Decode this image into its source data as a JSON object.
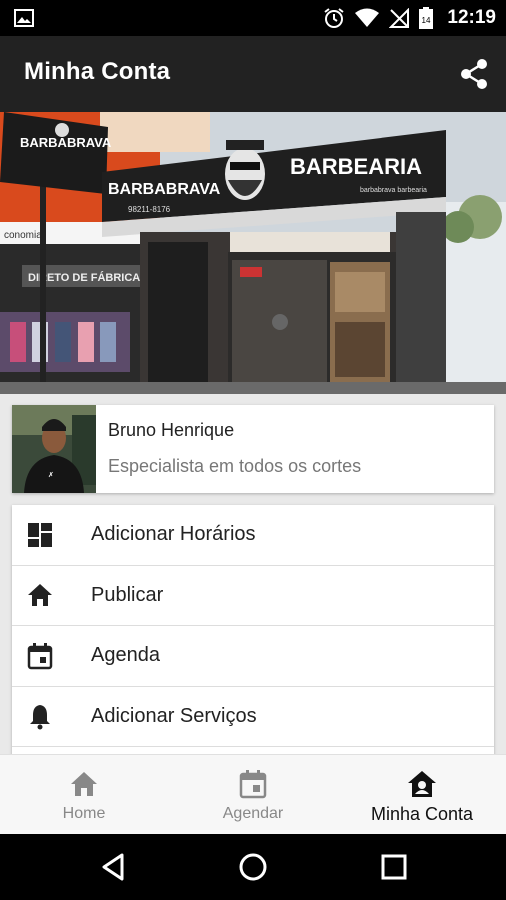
{
  "status_bar": {
    "time": "12:19"
  },
  "app_bar": {
    "title": "Minha Conta"
  },
  "hero": {
    "sign_left_brand": "BARBABRAVA",
    "sign_main_brand": "BARBABRAVA",
    "sign_main_title": "BARBEARIA",
    "sign_phone": "98211-8176",
    "sign_insta": "barbabrava barbearia",
    "store_left_sign": "DIRETO DE FÁBRICA",
    "store_left_text": "conomia"
  },
  "profile": {
    "name": "Bruno Henrique",
    "subtitle": "Especialista em todos os cortes"
  },
  "menu": {
    "items": [
      {
        "label": "Adicionar Horários",
        "icon": "dashboard-icon"
      },
      {
        "label": "Publicar",
        "icon": "home-icon"
      },
      {
        "label": "Agenda",
        "icon": "calendar-icon"
      },
      {
        "label": "Adicionar Serviços",
        "icon": "bell-icon"
      }
    ]
  },
  "bottom_nav": {
    "tabs": [
      {
        "label": "Home",
        "icon": "home-icon"
      },
      {
        "label": "Agendar",
        "icon": "calendar-icon"
      },
      {
        "label": "Minha Conta",
        "icon": "account-home-icon",
        "active": true
      }
    ]
  },
  "colors": {
    "app_bar": "#222222",
    "status_bar": "#000000",
    "background": "#e9e9e9",
    "active_tab": "#111111",
    "inactive_tab": "#888888"
  }
}
